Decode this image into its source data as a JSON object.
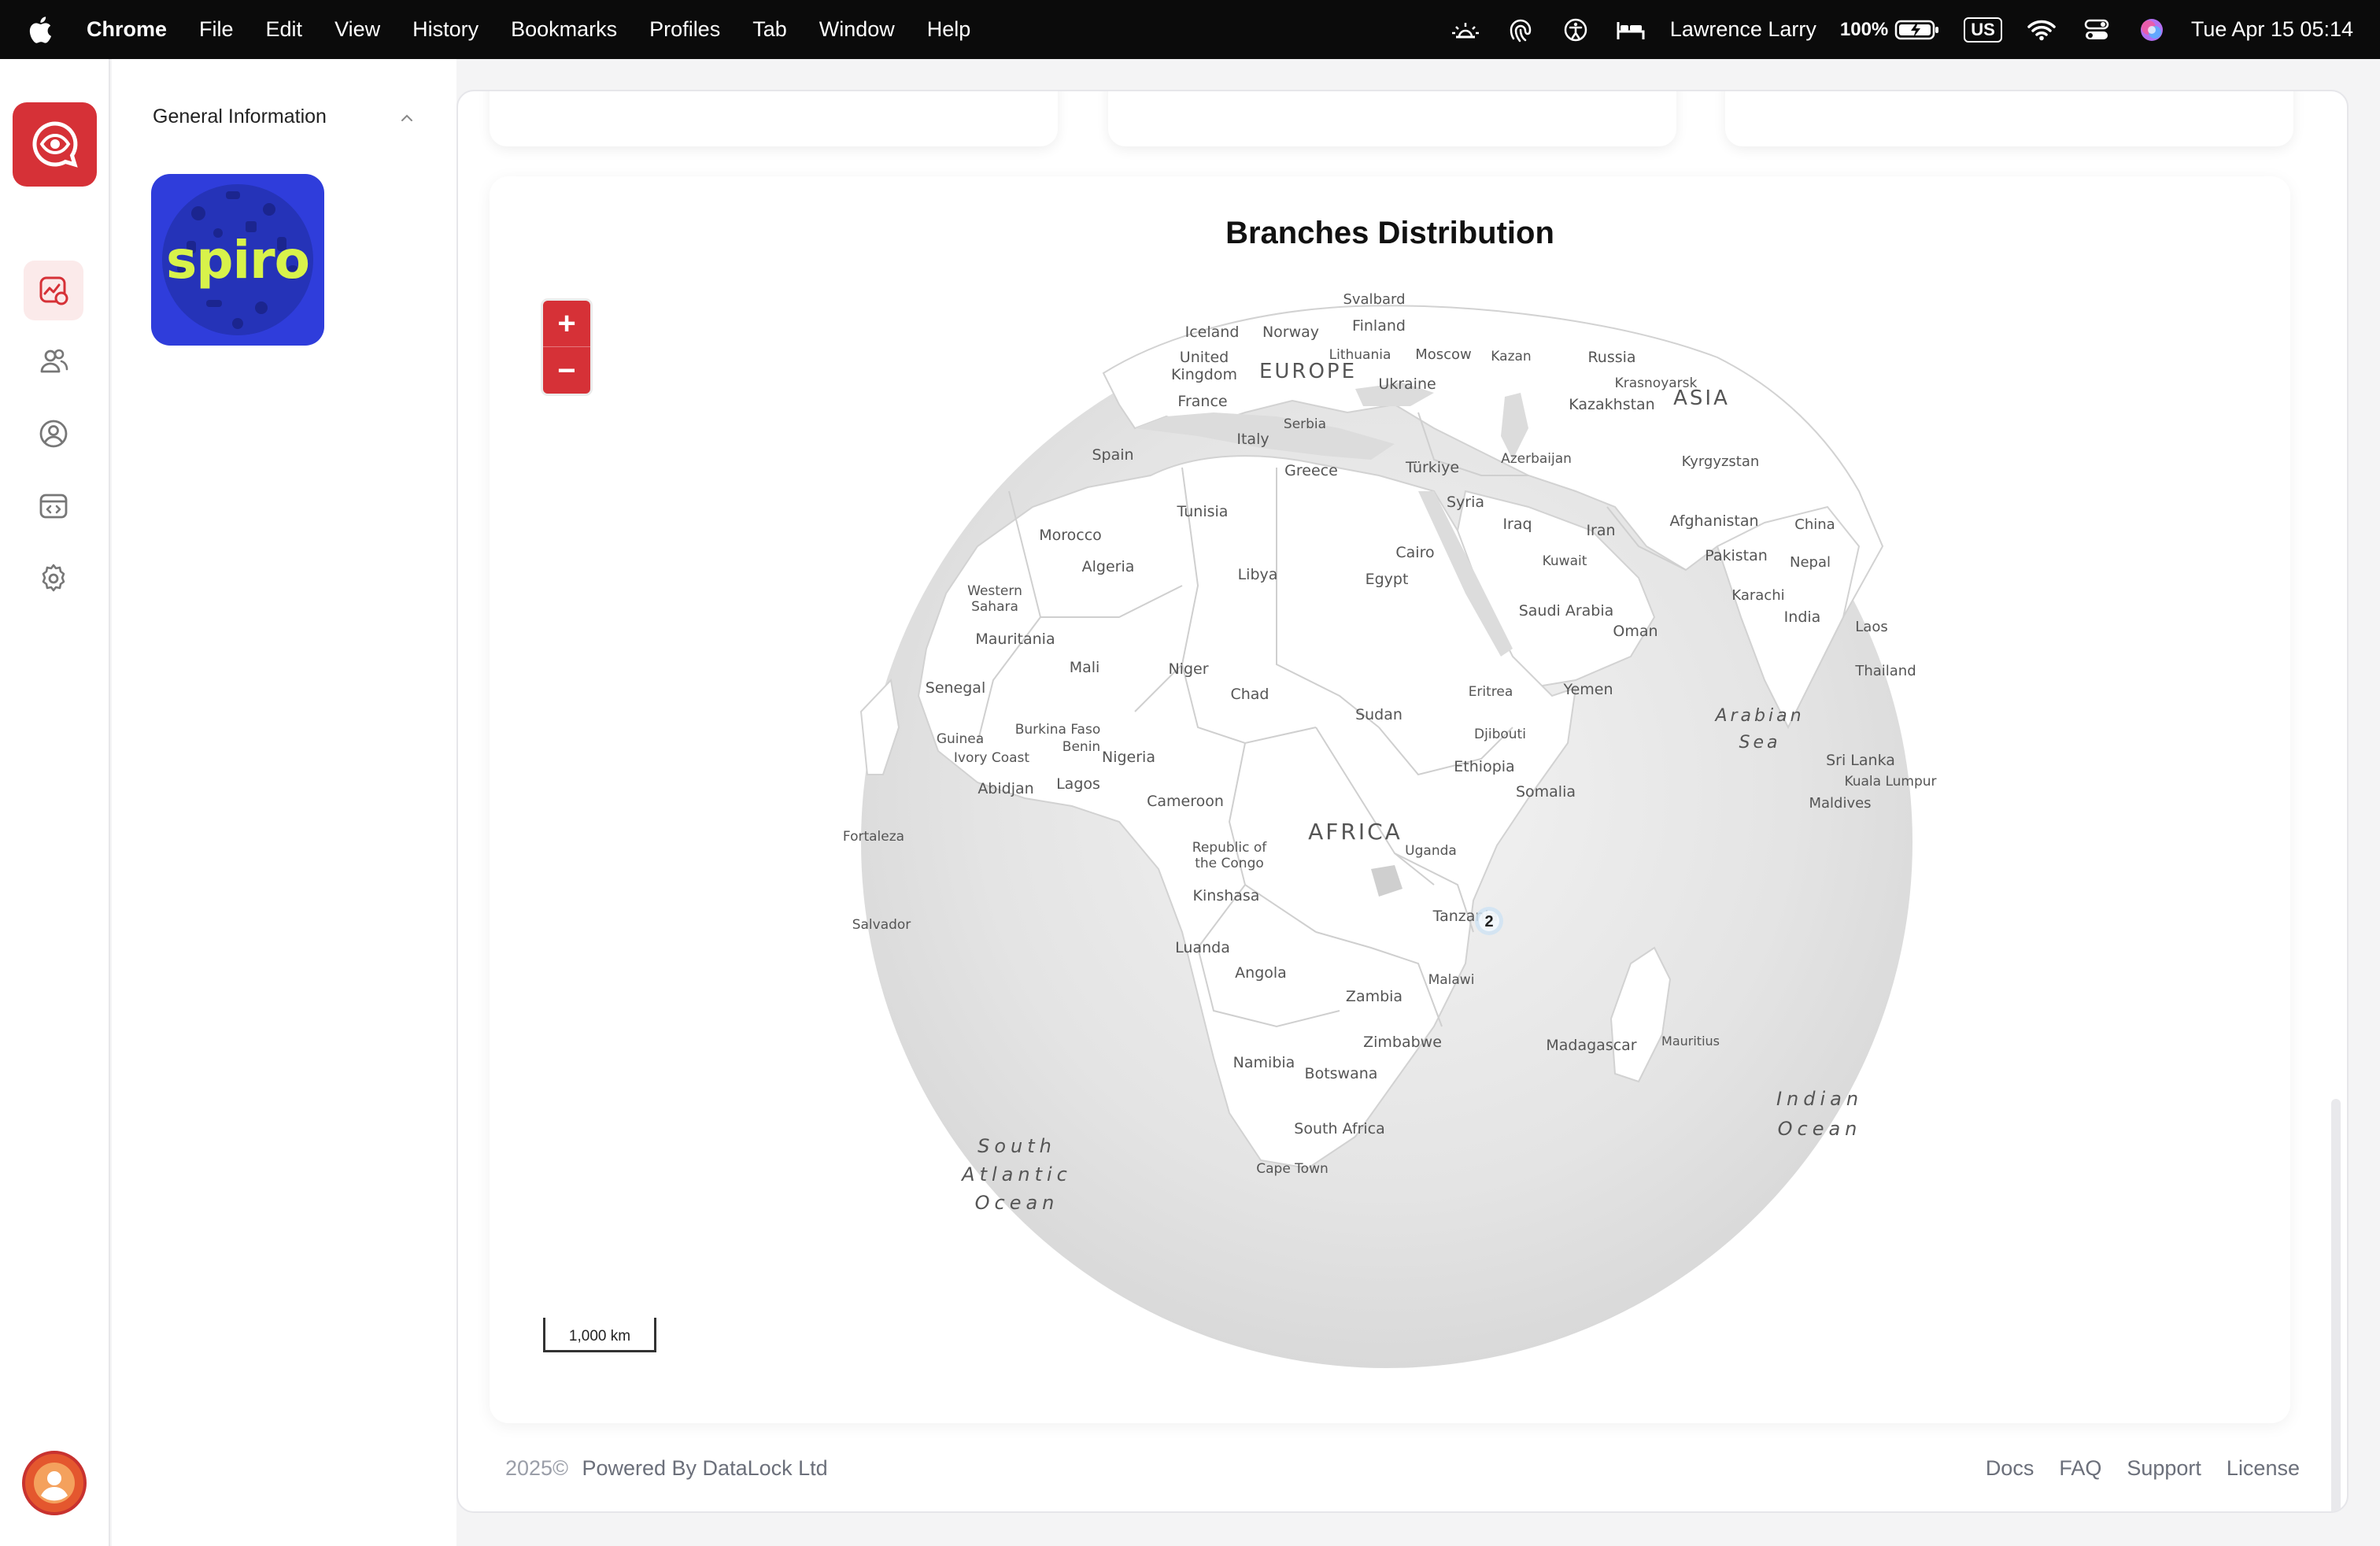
{
  "menubar": {
    "app_name": "Chrome",
    "items": [
      "File",
      "Edit",
      "View",
      "History",
      "Bookmarks",
      "Profiles",
      "Tab",
      "Window",
      "Help"
    ],
    "user": "Lawrence Larry",
    "battery": "100%",
    "input_source": "US",
    "clock": "Tue Apr 15  05:14"
  },
  "sidebar": {
    "nav_icons": [
      "dashboard-icon",
      "users-icon",
      "profile-icon",
      "code-window-icon",
      "settings-icon"
    ],
    "active_index": 0
  },
  "subnav": {
    "section_title": "General Information",
    "brand_word": "spiro"
  },
  "map": {
    "title": "Branches Distribution",
    "zoom_in": "+",
    "zoom_out": "−",
    "scale_label": "1,000 km",
    "cluster_count": "2",
    "regions": {
      "europe": "EUROPE",
      "asia": "ASIA",
      "africa": "AFRICA",
      "south_atlantic": [
        "South",
        "Atlantic",
        "Ocean"
      ],
      "indian_ocean": [
        "Indian",
        "Ocean"
      ],
      "arabian_sea": [
        "Arabian",
        "Sea"
      ]
    },
    "places": [
      "Svalbard",
      "Iceland",
      "Norway",
      "Finland",
      "United",
      "Kingdom",
      "Lithuania",
      "Moscow",
      "Kazan",
      "Russia",
      "Krasnoyarsk",
      "Kazakhstan",
      "France",
      "Ukraine",
      "Serbia",
      "Italy",
      "Spain",
      "Greece",
      "Türkiye",
      "Azerbaijan",
      "Kyrgyzstan",
      "Syria",
      "Iraq",
      "Iran",
      "Afghanistan",
      "China",
      "Tunisia",
      "Morocco",
      "Cairo",
      "Kuwait",
      "Pakistan",
      "Nepal",
      "Algeria",
      "Libya",
      "Egypt",
      "Karachi",
      "Western",
      "Sahara",
      "Saudi Arabia",
      "Oman",
      "India",
      "Laos",
      "Mauritania",
      "Mali",
      "Niger",
      "Thailand",
      "Senegal",
      "Chad",
      "Eritrea",
      "Yemen",
      "Sudan",
      "Burkina Faso",
      "Guinea",
      "Benin",
      "Djibouti",
      "Nigeria",
      "Ivory Coast",
      "Ethiopia",
      "Sri Lanka",
      "Abidjan",
      "Lagos",
      "Kuala Lumpur",
      "Somalia",
      "Cameroon",
      "Maldives",
      "Fortaleza",
      "Uganda",
      "Republic of",
      "the Congo",
      "Kinshasa",
      "Salvador",
      "Tanzania",
      "Luanda",
      "Angola",
      "Malawi",
      "Zambia",
      "Zimbabwe",
      "Madagascar",
      "Mauritius",
      "Namibia",
      "Botswana",
      "South Africa",
      "Cape Town"
    ]
  },
  "footer": {
    "year": "2025©",
    "powered": "Powered By DataLock Ltd",
    "links": [
      "Docs",
      "FAQ",
      "Support",
      "License"
    ]
  }
}
